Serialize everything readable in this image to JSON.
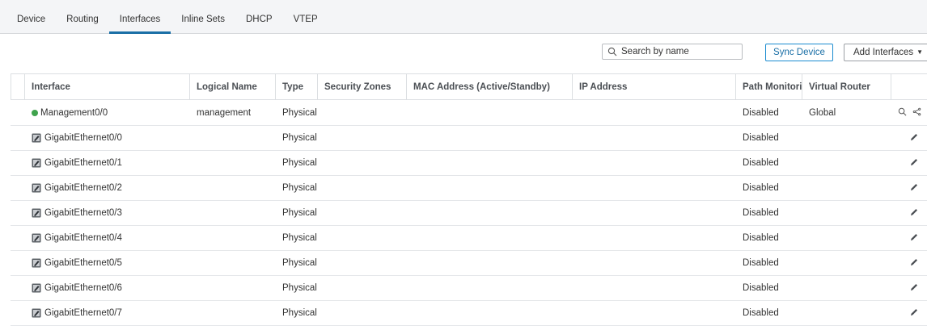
{
  "tabs": [
    "Device",
    "Routing",
    "Interfaces",
    "Inline Sets",
    "DHCP",
    "VTEP"
  ],
  "active_tab": "Interfaces",
  "search": {
    "placeholder": "Search by name"
  },
  "buttons": {
    "sync": "Sync Device",
    "add": "Add Interfaces"
  },
  "columns": {
    "interface": "Interface",
    "logical_name": "Logical Name",
    "type": "Type",
    "security_zones": "Security Zones",
    "mac": "MAC Address (Active/Standby)",
    "ip": "IP Address",
    "path_monitoring": "Path Monitoring",
    "virtual_router": "Virtual Router"
  },
  "rows": [
    {
      "interface": "Management0/0",
      "logical_name": "management",
      "type": "Physical",
      "security_zones": "",
      "mac": "",
      "ip": "",
      "path_monitoring": "Disabled",
      "virtual_router": "Global",
      "status_icon": "green-status-dot",
      "actions": [
        "search-icon",
        "share-icon"
      ]
    },
    {
      "interface": "GigabitEthernet0/0",
      "logical_name": "",
      "type": "Physical",
      "security_zones": "",
      "mac": "",
      "ip": "",
      "path_monitoring": "Disabled",
      "virtual_router": "",
      "status_icon": "interface-icon",
      "actions": [
        "edit-icon"
      ]
    },
    {
      "interface": "GigabitEthernet0/1",
      "logical_name": "",
      "type": "Physical",
      "security_zones": "",
      "mac": "",
      "ip": "",
      "path_monitoring": "Disabled",
      "virtual_router": "",
      "status_icon": "interface-icon",
      "actions": [
        "edit-icon"
      ]
    },
    {
      "interface": "GigabitEthernet0/2",
      "logical_name": "",
      "type": "Physical",
      "security_zones": "",
      "mac": "",
      "ip": "",
      "path_monitoring": "Disabled",
      "virtual_router": "",
      "status_icon": "interface-icon",
      "actions": [
        "edit-icon"
      ]
    },
    {
      "interface": "GigabitEthernet0/3",
      "logical_name": "",
      "type": "Physical",
      "security_zones": "",
      "mac": "",
      "ip": "",
      "path_monitoring": "Disabled",
      "virtual_router": "",
      "status_icon": "interface-icon",
      "actions": [
        "edit-icon"
      ]
    },
    {
      "interface": "GigabitEthernet0/4",
      "logical_name": "",
      "type": "Physical",
      "security_zones": "",
      "mac": "",
      "ip": "",
      "path_monitoring": "Disabled",
      "virtual_router": "",
      "status_icon": "interface-icon",
      "actions": [
        "edit-icon"
      ]
    },
    {
      "interface": "GigabitEthernet0/5",
      "logical_name": "",
      "type": "Physical",
      "security_zones": "",
      "mac": "",
      "ip": "",
      "path_monitoring": "Disabled",
      "virtual_router": "",
      "status_icon": "interface-icon",
      "actions": [
        "edit-icon"
      ]
    },
    {
      "interface": "GigabitEthernet0/6",
      "logical_name": "",
      "type": "Physical",
      "security_zones": "",
      "mac": "",
      "ip": "",
      "path_monitoring": "Disabled",
      "virtual_router": "",
      "status_icon": "interface-icon",
      "actions": [
        "edit-icon"
      ]
    },
    {
      "interface": "GigabitEthernet0/7",
      "logical_name": "",
      "type": "Physical",
      "security_zones": "",
      "mac": "",
      "ip": "",
      "path_monitoring": "Disabled",
      "virtual_router": "",
      "status_icon": "interface-icon",
      "actions": [
        "edit-icon"
      ]
    }
  ],
  "colors": {
    "accent": "#1a6fa6",
    "status_up": "#3fa34d"
  }
}
